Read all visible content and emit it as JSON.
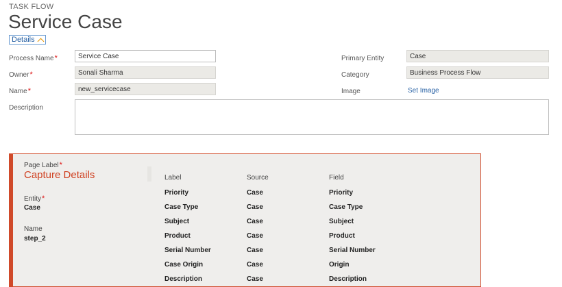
{
  "header": {
    "kicker": "TASK FLOW",
    "title": "Service Case",
    "details_label": "Details"
  },
  "form": {
    "process_name": {
      "label": "Process Name",
      "value": "Service Case"
    },
    "owner": {
      "label": "Owner",
      "value": "Sonali Sharma"
    },
    "name": {
      "label": "Name",
      "value": "new_servicecase"
    },
    "description": {
      "label": "Description",
      "value": ""
    },
    "primary_entity": {
      "label": "Primary Entity",
      "value": "Case"
    },
    "category": {
      "label": "Category",
      "value": "Business Process Flow"
    },
    "image": {
      "label": "Image",
      "link": "Set Image"
    },
    "required_mark": "*"
  },
  "stage": {
    "page_label_caption": "Page Label",
    "page_label": "Capture Details",
    "entity_caption": "Entity",
    "entity": "Case",
    "name_caption": "Name",
    "name": "step_2",
    "columns": {
      "label": "Label",
      "source": "Source",
      "field": "Field"
    },
    "rows": [
      {
        "label": "Priority",
        "source": "Case",
        "field": "Priority"
      },
      {
        "label": "Case Type",
        "source": "Case",
        "field": "Case Type"
      },
      {
        "label": "Subject",
        "source": "Case",
        "field": "Subject"
      },
      {
        "label": "Product",
        "source": "Case",
        "field": "Product"
      },
      {
        "label": "Serial Number",
        "source": "Case",
        "field": "Serial Number"
      },
      {
        "label": "Case Origin",
        "source": "Case",
        "field": "Origin"
      },
      {
        "label": "Description",
        "source": "Case",
        "field": "Description"
      }
    ]
  },
  "colors": {
    "accent": "#d04a2a",
    "link": "#2660a4",
    "readonly_bg": "#ebeae6",
    "stage_bg": "#efeeec"
  }
}
